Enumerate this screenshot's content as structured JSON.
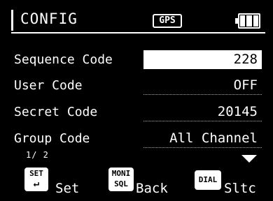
{
  "header": {
    "title": "CONFIG",
    "gps_badge": "GPS",
    "battery_icon": "battery-full-icon"
  },
  "rows": [
    {
      "label": "Sequence Code",
      "value": "228",
      "selected": true
    },
    {
      "label": "User Code",
      "value": "OFF",
      "selected": false
    },
    {
      "label": "Secret Code",
      "value": "20145",
      "selected": false
    },
    {
      "label": "Group Code",
      "value": "All Channel",
      "selected": false
    }
  ],
  "page_indicator": "1/ 2",
  "more_icon": "down-triangle-icon",
  "softkeys": [
    {
      "key_top": "SET",
      "key_bottom": "↵",
      "label": "Set"
    },
    {
      "key_top": "MONI",
      "key_bottom": "SQL",
      "label": "Back"
    },
    {
      "key_top": "DIAL",
      "key_bottom": "",
      "label": "Sltc"
    }
  ],
  "colors": {
    "background": "#000000",
    "foreground": "#ffffff"
  }
}
